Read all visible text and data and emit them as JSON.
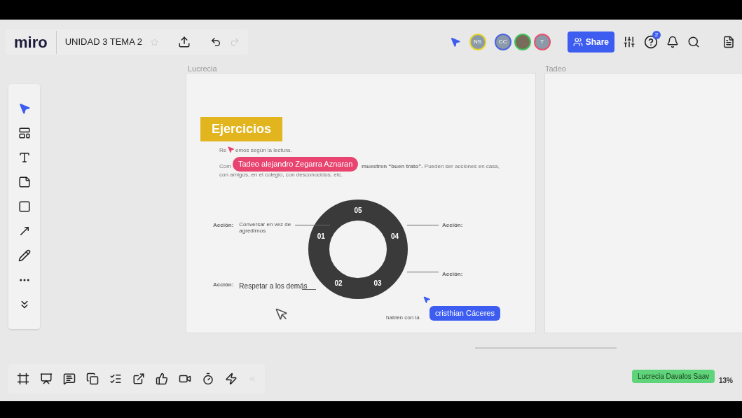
{
  "topbar": {
    "logo": "miro",
    "board_title": "UNIDAD 3 TEMA 2",
    "starred": false,
    "avatars": [
      {
        "initials": "NS",
        "color": "#e8d32a",
        "kind": "initials"
      },
      {
        "initials": "CC",
        "color": "#4a63e0",
        "kind": "initials"
      },
      {
        "color": "#3fc45a",
        "kind": "photo"
      },
      {
        "initials": "T",
        "color": "#e8506e",
        "kind": "initials"
      }
    ],
    "share": "Share",
    "help_badge": "2"
  },
  "tools": [
    {
      "kind": "select",
      "selected": true
    },
    {
      "kind": "templates",
      "selected": false
    },
    {
      "kind": "text",
      "selected": false
    },
    {
      "kind": "sticky",
      "selected": false
    },
    {
      "kind": "shape",
      "selected": false
    },
    {
      "kind": "arrow",
      "selected": false
    },
    {
      "kind": "pen",
      "selected": false
    },
    {
      "kind": "more",
      "selected": false
    },
    {
      "kind": "expand",
      "selected": false
    }
  ],
  "frames": [
    {
      "label": "Lucrecia"
    },
    {
      "label": "Tadeo"
    }
  ],
  "slide": {
    "title": "Ejercicios",
    "line1_start": "Re",
    "line1_end": "emos según la lectura.",
    "line2_start": "Com",
    "line2_end": "**muestren “buen trato”.** Pueden ser acciones en casa,",
    "line3": "con amigos, en el colegio, con desconocidos, etc.",
    "segments": [
      "01",
      "02",
      "03",
      "04",
      "05"
    ],
    "actions": [
      {
        "label": "Acción:",
        "answer": "Conversar en vez de agredirnos",
        "kind": "small"
      },
      {
        "label": "Acción:",
        "answer": "Respetar a los demás",
        "kind": "large"
      },
      {
        "label": "Acción:",
        "kind": "right"
      },
      {
        "label": "Acción:",
        "kind": "right"
      }
    ],
    "partial_answer": "hablen con la"
  },
  "cursors": [
    {
      "name": "Tadeo alejandro Zegarra Aznaran",
      "color": "#e8446f"
    },
    {
      "name": "cristhian Cáceres",
      "color": "#3d5cf0"
    }
  ],
  "bottom": {
    "collaborator": "Lucrecia Davalos Saav",
    "zoom": "13%"
  }
}
